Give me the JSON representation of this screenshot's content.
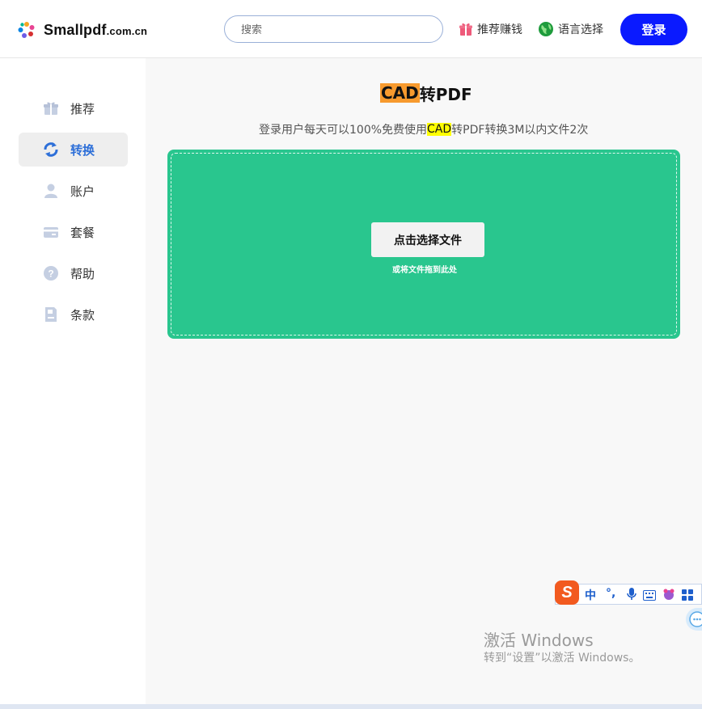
{
  "header": {
    "logo_text": "Smallpdf",
    "logo_suffix": ".com.cn",
    "search_placeholder": "搜索",
    "recommend_label": "推荐赚钱",
    "language_label": "语言选择",
    "login_label": "登录"
  },
  "sidebar": {
    "items": [
      {
        "label": "推荐",
        "icon": "gift-icon"
      },
      {
        "label": "转换",
        "icon": "convert-icon",
        "active": true
      },
      {
        "label": "账户",
        "icon": "user-icon"
      },
      {
        "label": "套餐",
        "icon": "card-icon"
      },
      {
        "label": "帮助",
        "icon": "help-icon"
      },
      {
        "label": "条款",
        "icon": "document-icon"
      }
    ]
  },
  "main": {
    "title_highlight": "CAD",
    "title_rest": "转PDF",
    "subtitle_before": "登录用户每天可以100%免费使用",
    "subtitle_highlight": "CAD",
    "subtitle_after": "转PDF转换3M以内文件2次",
    "choose_button": "点击选择文件",
    "drag_hint": "或将文件拖到此处"
  },
  "ime": {
    "logo": "S",
    "mode": "中",
    "punct": "°,"
  },
  "watermark": {
    "line1": "激活 Windows",
    "line2": "转到“设置”以激活 Windows。"
  },
  "colors": {
    "accent_blue": "#0a1aff",
    "drop_green": "#29c68e",
    "title_highlight": "#f79a2e",
    "subtitle_highlight": "#ffff00",
    "active_text": "#2d6fd8"
  }
}
